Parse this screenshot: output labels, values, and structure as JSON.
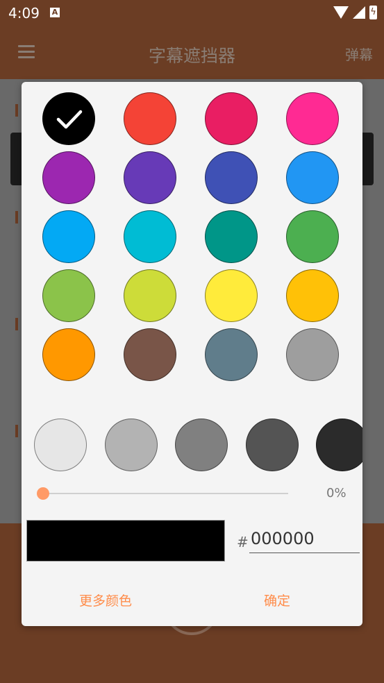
{
  "status_bar": {
    "time": "4:09",
    "notification_icon": "A"
  },
  "app_bar": {
    "title": "字幕遮挡器",
    "action": "弹幕",
    "menu_icon": "list-icon"
  },
  "dialog": {
    "palette": [
      [
        "#000000",
        "#F44336",
        "#E91E63",
        "#FF2A93"
      ],
      [
        "#9C27B0",
        "#673AB7",
        "#3F51B5",
        "#2196F3"
      ],
      [
        "#03A9F4",
        "#00BCD4",
        "#009688",
        "#4CAF50"
      ],
      [
        "#8BC34A",
        "#CDDC39",
        "#FFEB3B",
        "#FFC107"
      ],
      [
        "#FF9800",
        "#795548",
        "#607D8B",
        "#9E9E9E"
      ]
    ],
    "selected_color": "#000000",
    "shades": [
      "#E6E6E6",
      "#B3B3B3",
      "#808080",
      "#545454",
      "#2B2B2B"
    ],
    "transparency": {
      "value_label": "0%",
      "value": 0
    },
    "hex_prefix": "#",
    "hex_value": "000000",
    "preview_color": "#000000",
    "buttons": {
      "more": "更多颜色",
      "ok": "确定"
    }
  }
}
